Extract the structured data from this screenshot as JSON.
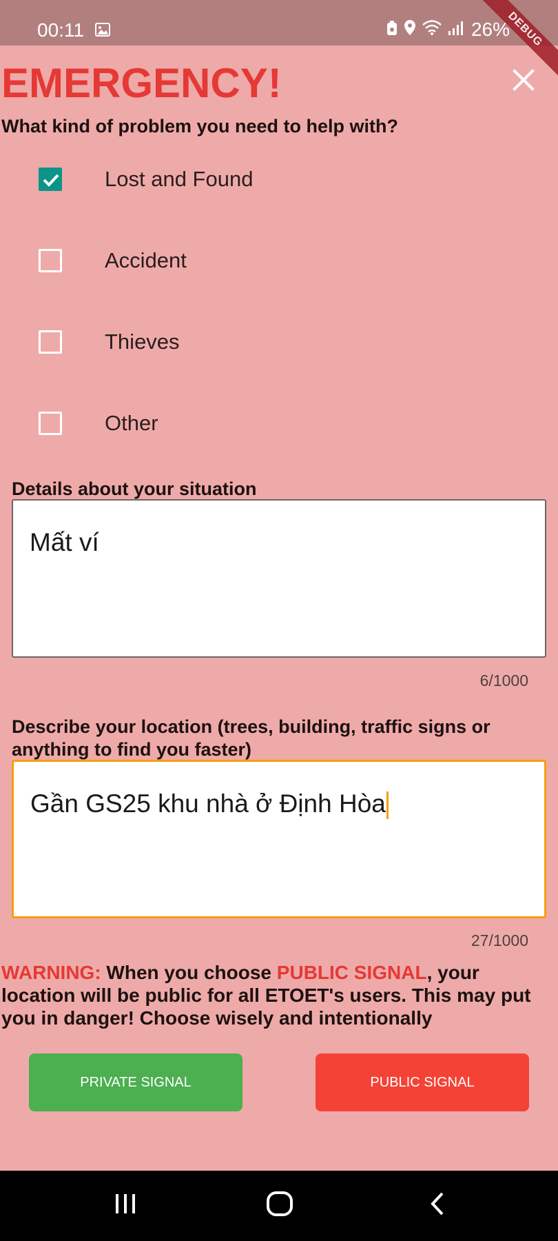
{
  "status_bar": {
    "time": "00:11",
    "battery": "26%"
  },
  "debug_banner": "DEBUG",
  "title": "EMERGENCY!",
  "question": "What kind of problem you need to help with?",
  "options": [
    {
      "label": "Lost and Found",
      "checked": true
    },
    {
      "label": "Accident",
      "checked": false
    },
    {
      "label": "Thieves",
      "checked": false
    },
    {
      "label": "Other",
      "checked": false
    }
  ],
  "details": {
    "label": "Details about your situation",
    "value": "Mất ví",
    "counter": "6/1000"
  },
  "location": {
    "label_line1": "Describe your location (trees, building, traffic signs or",
    "label_line2": "anything to find you faster)",
    "value": "Gần GS25 khu nhà ở Định Hòa",
    "counter": "27/1000"
  },
  "warning": {
    "prefix": "WARNING:",
    "text1": " When you choose ",
    "highlight": "PUBLIC SIGNAL",
    "text2": ", your location will be public for all ETOET's users. This may put you in danger! Choose wisely and intentionally"
  },
  "buttons": {
    "private": "PRIVATE SIGNAL",
    "public": "PUBLIC SIGNAL"
  },
  "colors": {
    "accent": "#e53935",
    "checkbox": "#0d9488",
    "private": "#4caf50",
    "public": "#f44336",
    "focus": "#f59f0a",
    "background": "#eeaaa9"
  }
}
